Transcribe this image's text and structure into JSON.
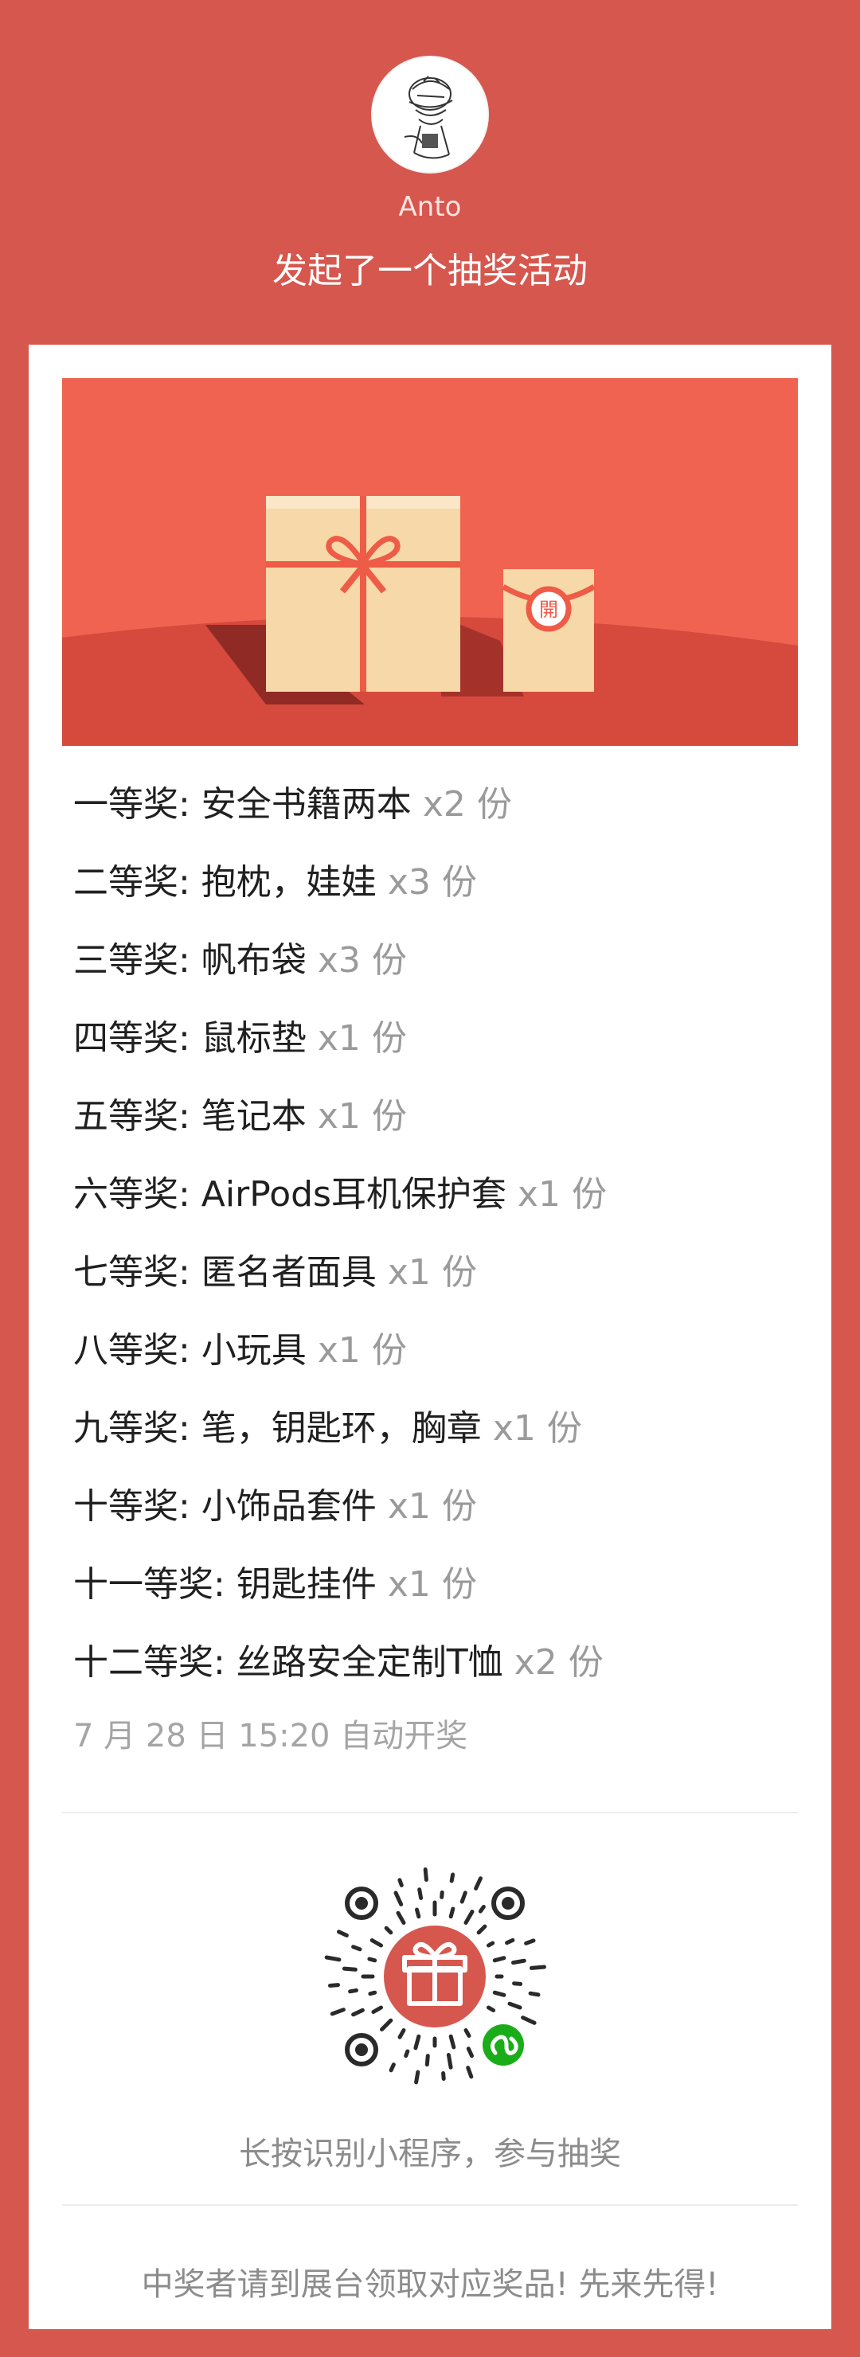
{
  "header": {
    "username": "Anto",
    "headline": "发起了一个抽奖活动"
  },
  "banner": {
    "badge_char": "開",
    "colors": {
      "sky": "#ef6350",
      "ground": "#d6493d",
      "box": "#f7d8a8",
      "ribbon": "#ee5b47"
    }
  },
  "prizes": [
    {
      "label": "一等奖: 安全书籍两本",
      "qty": "x2 份"
    },
    {
      "label": "二等奖: 抱枕，娃娃",
      "qty": "x3 份"
    },
    {
      "label": "三等奖: 帆布袋",
      "qty": "x3 份"
    },
    {
      "label": "四等奖: 鼠标垫",
      "qty": "x1 份"
    },
    {
      "label": "五等奖: 笔记本",
      "qty": "x1 份"
    },
    {
      "label": "六等奖: AirPods耳机保护套",
      "qty": "x1 份"
    },
    {
      "label": "七等奖: 匿名者面具",
      "qty": "x1 份"
    },
    {
      "label": "八等奖: 小玩具",
      "qty": "x1 份"
    },
    {
      "label": "九等奖: 笔，钥匙环，胸章",
      "qty": "x1 份"
    },
    {
      "label": "十等奖: 小饰品套件",
      "qty": "x1 份"
    },
    {
      "label": "十一等奖: 钥匙挂件",
      "qty": "x1 份"
    },
    {
      "label": "十二等奖: 丝路安全定制T恤",
      "qty": "x2 份"
    }
  ],
  "draw_time": "7 月 28 日 15:20 自动开奖",
  "qr": {
    "icon": "gift-icon",
    "badge_icon": "mini-program-icon",
    "caption": "长按识别小程序，参与抽奖"
  },
  "footer_note": "中奖者请到展台领取对应奖品! 先来先得!"
}
